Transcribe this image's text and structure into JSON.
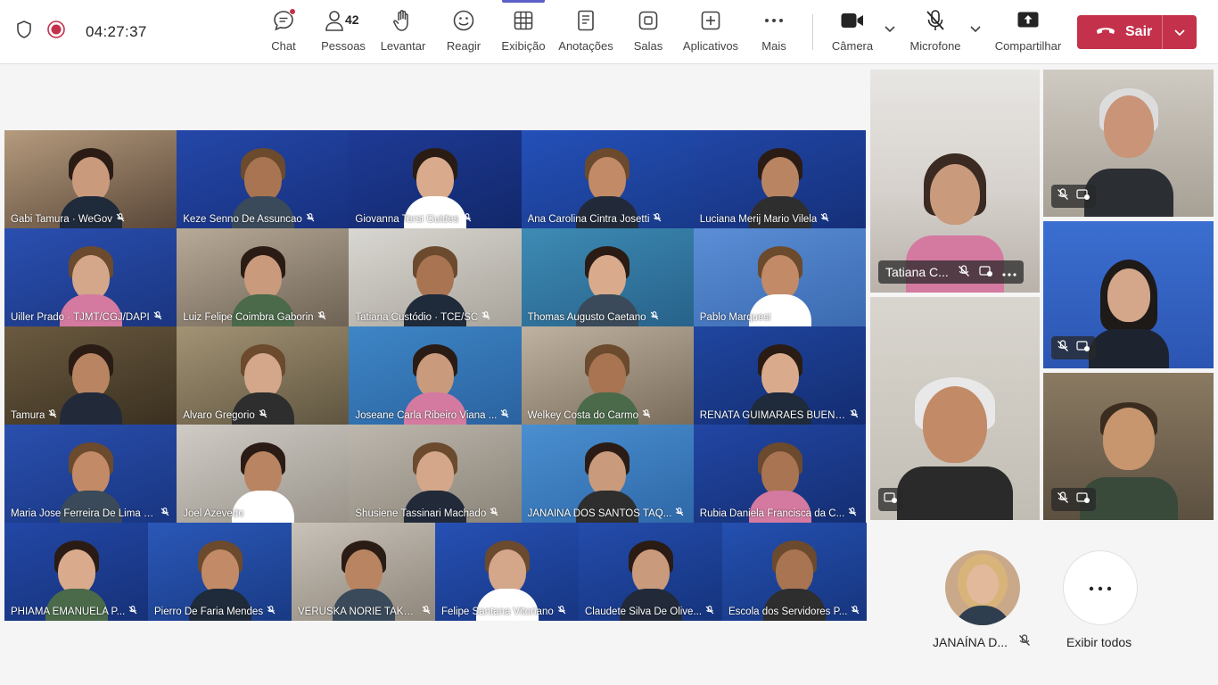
{
  "meeting": {
    "timer": "04:27:37"
  },
  "toolbar": {
    "chat_label": "Chat",
    "people_label": "Pessoas",
    "people_count": "42",
    "raise_label": "Levantar",
    "react_label": "Reagir",
    "view_label": "Exibição",
    "notes_label": "Anotações",
    "rooms_label": "Salas",
    "apps_label": "Aplicativos",
    "more_label": "Mais",
    "camera_label": "Câmera",
    "mic_label": "Microfone",
    "share_label": "Compartilhar",
    "leave_label": "Sair"
  },
  "gallery": {
    "rows": [
      [
        "Gabi Tamura · WeGov",
        "Keze Senno De Assuncao",
        "Giovanna Tersi Guides",
        "Ana Carolina Cintra Josetti",
        "Luciana Merij Mario Vilela"
      ],
      [
        "Uiller Prado · TJMT/CGJ/DAPI",
        "Luiz Felipe Coimbra Gaborin",
        "Tatiana Custódio · TCE/SC",
        "Thomas Augusto Caetano",
        "Pablo Marquesi"
      ],
      [
        "Tamura",
        "Alvaro Gregorio",
        "Joseane Carla Ribeiro Viana ...",
        "Welkey Costa do Carmo",
        "RENATA GUIMARAES BUENO..."
      ],
      [
        "Maria Jose Ferreira De Lima S...",
        "Joel Azevedo",
        "Shusiene Tassinari Machado",
        "JANAÍNA DOS SANTOS TAQ...",
        "Rubia Daniela Francisca da C..."
      ],
      [
        "PHIAMA EMANUELA P...",
        "Pierro De Faria Mendes",
        "VERUSKA NORIE TAKA...",
        "Felipe Santana Vitoriano",
        "Claudete Silva De Olive...",
        "Escola dos Servidores P..."
      ]
    ]
  },
  "stage": {
    "featured_name": "Tatiana C..."
  },
  "bottom": {
    "avatar_name": "JANAÍNA D...",
    "show_all_label": "Exibir todos"
  },
  "colors": {
    "accent": "#5b5fc7",
    "leave": "#c4314b",
    "tile_blue": "#1d3fa0"
  }
}
